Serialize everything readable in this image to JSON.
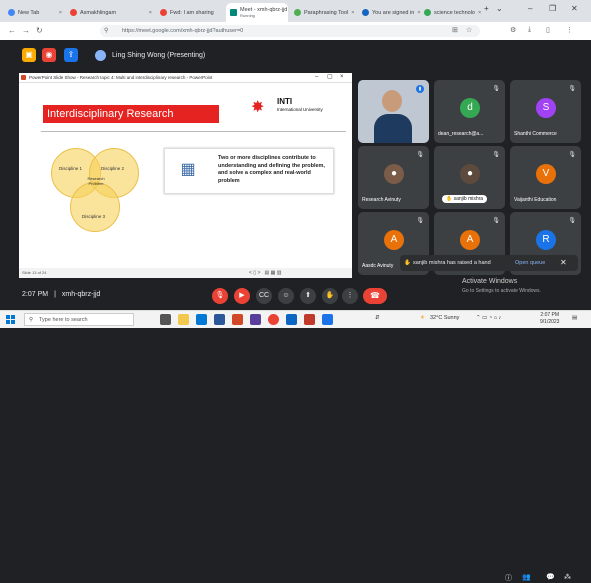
{
  "browser": {
    "tabs": [
      {
        "label": "New Tab",
        "color": "#4285f4"
      },
      {
        "label": "Asmakhlingam",
        "color": "#ea4335"
      },
      {
        "label": "Fwd: I am sharing",
        "color": "#ea4335"
      },
      {
        "label": "Meet - xmh-qbrz-jjd",
        "color": "#00897b"
      },
      {
        "label": "Paraphrasing Tool",
        "color": "#4caf50"
      },
      {
        "label": "You are signed in",
        "color": "#1565c0"
      },
      {
        "label": "science technolo",
        "color": "#34a853"
      }
    ],
    "active_tab_sub": "Running",
    "url": "https://meet.google.com/xmh-qbrz-jjd?authuser=0"
  },
  "meet_top": {
    "presenting_label": "Ling Shing Wong (Presenting)"
  },
  "slide_window": {
    "title": "PowerPoint Slide Show - Research topic 4: Multi and interdisciplinary research - PowerPoint",
    "status_left": "Slide 13 of 24",
    "slide_title": "Interdisciplinary Research",
    "logo_main": "INTI",
    "logo_sub": "International University",
    "venn": {
      "discipline_1": "Discipline 1",
      "discipline_2": "Discipline 2",
      "discipline_3": "Discipline 3",
      "center": "Research Problem"
    },
    "card_text": "Two or more disciplines contribute to understanding and defining the problem, and solve a complex and real-world problem"
  },
  "participants": [
    {
      "name": "",
      "type": "video",
      "mic": "speaking"
    },
    {
      "name": "dean_research@a...",
      "initial": "d",
      "color": "#34a853"
    },
    {
      "name": "Shanthi Commerce",
      "initial": "S",
      "color": "#a142f4"
    },
    {
      "name": "Research Avinuty",
      "type": "photo"
    },
    {
      "name": "sanjib mishra",
      "type": "photo",
      "hand": true
    },
    {
      "name": "Vaijanthi Education",
      "initial": "V",
      "color": "#e8710a"
    },
    {
      "name": "Aasdc Avinuty",
      "initial": "A",
      "color": "#e8710a"
    },
    {
      "name": "",
      "initial": "A",
      "color": "#e8710a"
    },
    {
      "name": "",
      "initial": "R",
      "color": "#1a73e8"
    }
  ],
  "raise_hand": {
    "message": "sanjib mishra has raised a hand",
    "action": "Open queue"
  },
  "bottom": {
    "time": "2:07 PM",
    "meeting_code": "xmh-qbrz-jjd"
  },
  "watermark": {
    "line1": "Activate Windows",
    "line2": "Go to Settings to activate Windows."
  },
  "taskbar": {
    "search_placeholder": "Type here to search",
    "weather": "32°C Sunny",
    "time": "2:07 PM",
    "date": "9/1/2023"
  }
}
